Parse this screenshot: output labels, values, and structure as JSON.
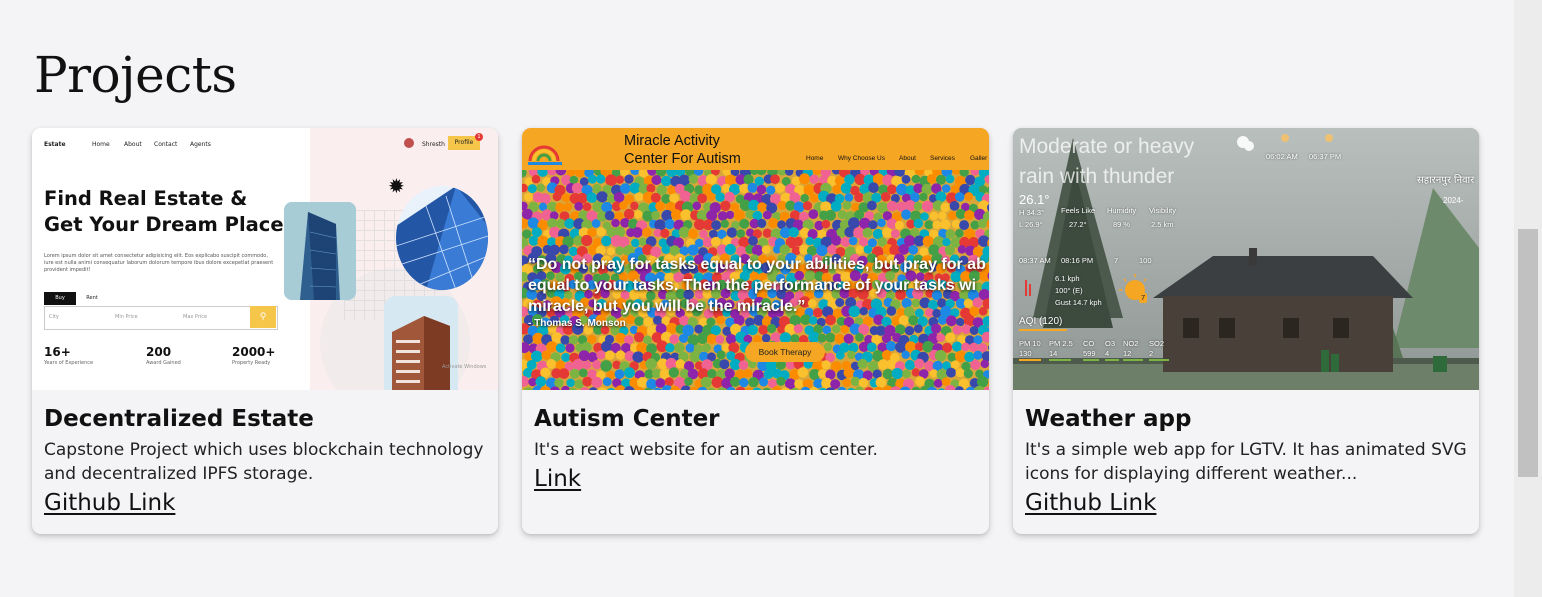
{
  "page": {
    "title": "Projects"
  },
  "projects": [
    {
      "title": "Decentralized Estate",
      "description": "Capstone Project which uses blockchain technology and decentralized IPFS storage.",
      "link_label": "Github Link",
      "thumbnail": {
        "logo": "Estate",
        "nav": [
          "Home",
          "About",
          "Contact",
          "Agents"
        ],
        "user": "Shresth",
        "profile_label": "Profile",
        "badge": "1",
        "hero": "Find Real Estate & Get Your Dream Place",
        "lorem": "Lorem ipsum dolor sit amet consectetur adipisicing elit. Eos explicabo suscipit commodo, iure est nulla animi consequatur laborum dolorum tempore ibus dolore excepetlat praesent provident impedit!",
        "tab_buy": "Buy",
        "tab_rent": "Rent",
        "search_fields": [
          "City",
          "Min Price",
          "Max Price"
        ],
        "stats": [
          {
            "number": "16+",
            "label": "Years of Experience"
          },
          {
            "number": "200",
            "label": "Award Gained"
          },
          {
            "number": "2000+",
            "label": "Property Ready"
          }
        ],
        "watermark": "Activate Windows"
      }
    },
    {
      "title": "Autism Center",
      "description": "It's a react website for an autism center.",
      "link_label": "Link",
      "thumbnail": {
        "brand_line1": "Miracle Activity",
        "brand_line2": "Center For Autism",
        "nav": [
          "Home",
          "Why Choose Us",
          "About",
          "Services",
          "Galler"
        ],
        "quote_line1": "“Do not pray for tasks equal to your abilities, but pray for ab",
        "quote_line2": "equal to your tasks. Then the performance of your tasks wi",
        "quote_line3": "miracle, but you will be the miracle.”",
        "author": "- Thomas S. Monson",
        "cta": "Book Therapy",
        "colors": {
          "bar": "#f5a623"
        }
      }
    },
    {
      "title": "Weather app",
      "description": "It's a simple web app for LGTV. It has animated SVG icons for displaying different weather...",
      "link_label": "Github Link",
      "thumbnail": {
        "condition_line1": "Moderate or heavy",
        "condition_line2": "rain with thunder",
        "sunrise": "06:02 AM",
        "sunset": "06:37 PM",
        "city": "सहारनपुर निवार",
        "date": "2024-",
        "temp": "26.1°",
        "high": "H 34.3°",
        "low": "L 26.9°",
        "feels_like_label": "Feels Like",
        "feels_like": "27.2°",
        "humidity_label": "Humidity",
        "humidity": "89 %",
        "visibility_label": "Visibility",
        "visibility": "2.5 km",
        "times": [
          "08:37 AM",
          "08:16 PM",
          "7",
          "100"
        ],
        "wind_speed": "6.1 kph",
        "wind_dir": "100° (E)",
        "gust": "Gust 14.7 kph",
        "uv": "7",
        "aqi": "AQI (120)",
        "pollutants": [
          {
            "name": "PM 10",
            "value": "130",
            "color": "#f5a623"
          },
          {
            "name": "PM 2.5",
            "value": "14",
            "color": "#7cb342"
          },
          {
            "name": "CO",
            "value": "599",
            "color": "#7cb342"
          },
          {
            "name": "O3",
            "value": "4",
            "color": "#7cb342"
          },
          {
            "name": "NO2",
            "value": "12",
            "color": "#7cb342"
          },
          {
            "name": "SO2",
            "value": "2",
            "color": "#7cb342"
          }
        ]
      }
    }
  ]
}
